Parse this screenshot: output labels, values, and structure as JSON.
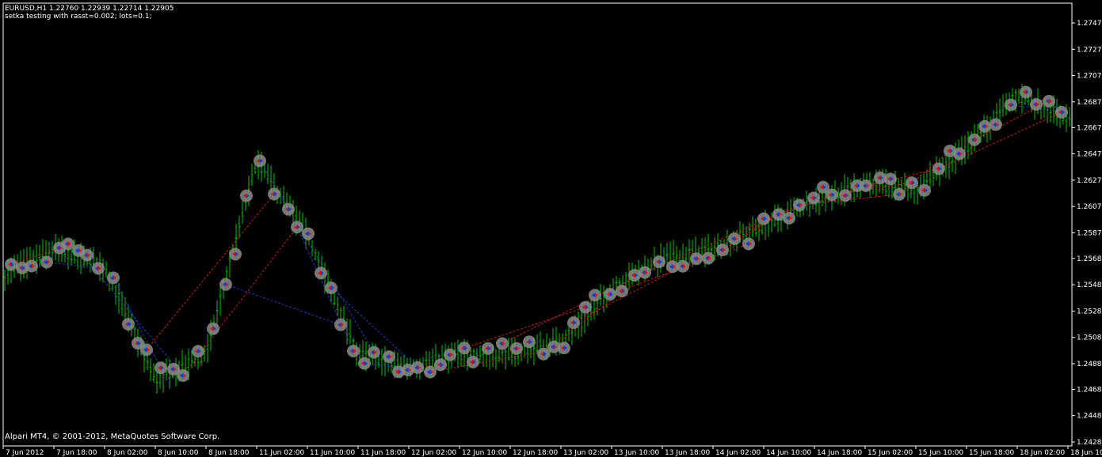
{
  "header": {
    "symbol_line": "EURUSD,H1  1.22760 1.22939 1.22714 1.22905",
    "comment_line": "setka testing with rasst=0.002; lots=0.1;"
  },
  "copyright": "Alpari MT4, © 2001-2012, MetaQuotes Software Corp.",
  "colors": {
    "background": "#000000",
    "candles": "#00c800",
    "buy_lines": "#1a3ccc",
    "sell_lines": "#d01818",
    "marker_ring": "#8a8a8a",
    "axis": "#ffffff"
  },
  "chart_data": {
    "type": "candlestick",
    "symbol": "EURUSD",
    "timeframe": "H1",
    "ylim": [
      1.24285,
      1.2747
    ],
    "y_ticks": [
      1.2747,
      1.2727,
      1.2707,
      1.2687,
      1.26675,
      1.26475,
      1.26275,
      1.26075,
      1.25875,
      1.2568,
      1.2548,
      1.2528,
      1.2508,
      1.2488,
      1.24685,
      1.24485,
      1.24285
    ],
    "y_tick_labels": [
      "1.27470",
      "1.27270",
      "1.27070",
      "1.26870",
      "1.26675",
      "1.26475",
      "1.26275",
      "1.26075",
      "1.25875",
      "1.25680",
      "1.25480",
      "1.25280",
      "1.25080",
      "1.24880",
      "1.24685",
      "1.24485",
      "1.24285"
    ],
    "x_tick_labels": [
      "7 Jun 2012",
      "7 Jun 18:00",
      "8 Jun 02:00",
      "8 Jun 10:00",
      "8 Jun 18:00",
      "11 Jun 02:00",
      "11 Jun 10:00",
      "11 Jun 18:00",
      "12 Jun 02:00",
      "12 Jun 10:00",
      "12 Jun 18:00",
      "13 Jun 02:00",
      "13 Jun 10:00",
      "13 Jun 18:00",
      "14 Jun 02:00",
      "14 Jun 10:00",
      "14 Jun 18:00",
      "15 Jun 02:00",
      "15 Jun 10:00",
      "15 Jun 18:00",
      "18 Jun 02:00",
      "18 Jun 10:"
    ],
    "close_path": [
      [
        "7 Jun 2012",
        1.2555
      ],
      [
        "7 Jun 18:00",
        1.2575
      ],
      [
        "8 Jun 02:00",
        1.2562
      ],
      [
        "8 Jun 10:00",
        1.2475
      ],
      [
        "8 Jun 18:00",
        1.2495
      ],
      [
        "11 Jun 02:00",
        1.2642
      ],
      [
        "11 Jun 10:00",
        1.2585
      ],
      [
        "11 Jun 18:00",
        1.2495
      ],
      [
        "12 Jun 02:00",
        1.2485
      ],
      [
        "12 Jun 10:00",
        1.2495
      ],
      [
        "12 Jun 18:00",
        1.2495
      ],
      [
        "13 Jun 02:00",
        1.2505
      ],
      [
        "13 Jun 10:00",
        1.2545
      ],
      [
        "13 Jun 18:00",
        1.2568
      ],
      [
        "14 Jun 02:00",
        1.2575
      ],
      [
        "14 Jun 10:00",
        1.2592
      ],
      [
        "14 Jun 18:00",
        1.2612
      ],
      [
        "15 Jun 02:00",
        1.2625
      ],
      [
        "15 Jun 10:00",
        1.262
      ],
      [
        "15 Jun 18:00",
        1.2652
      ],
      [
        "18 Jun 02:00",
        1.2692
      ],
      [
        "18 Jun 10:",
        1.2675
      ]
    ]
  }
}
